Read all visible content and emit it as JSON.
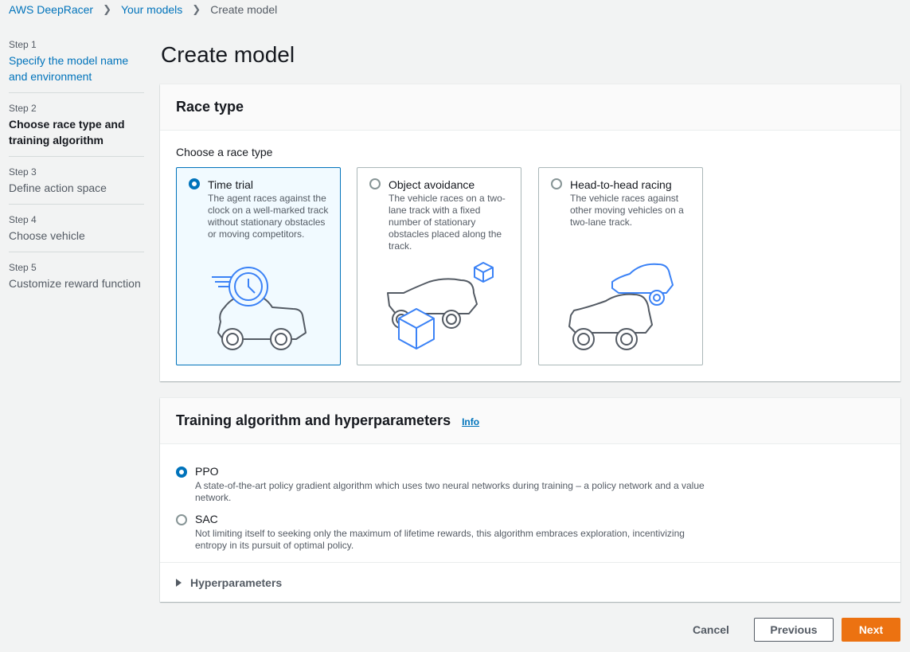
{
  "breadcrumb": {
    "items": [
      "AWS DeepRacer",
      "Your models"
    ],
    "current": "Create model"
  },
  "steps": [
    {
      "num": "Step 1",
      "label": "Specify the model name and environment",
      "state": "link"
    },
    {
      "num": "Step 2",
      "label": "Choose race type and training algorithm",
      "state": "active"
    },
    {
      "num": "Step 3",
      "label": "Define action space",
      "state": "disabled"
    },
    {
      "num": "Step 4",
      "label": "Choose vehicle",
      "state": "disabled"
    },
    {
      "num": "Step 5",
      "label": "Customize reward function",
      "state": "disabled"
    }
  ],
  "page_title": "Create model",
  "race_panel": {
    "title": "Race type",
    "choose_label": "Choose a race type",
    "tiles": [
      {
        "title": "Time trial",
        "desc": "The agent races against the clock on a well-marked track without stationary obstacles or moving competitors.",
        "selected": true
      },
      {
        "title": "Object avoidance",
        "desc": "The vehicle races on a two-lane track with a fixed number of stationary obstacles placed along the track.",
        "selected": false
      },
      {
        "title": "Head-to-head racing",
        "desc": "The vehicle races against other moving vehicles on a two-lane track.",
        "selected": false
      }
    ]
  },
  "algo_panel": {
    "title": "Training algorithm and hyperparameters",
    "info": "Info",
    "options": [
      {
        "title": "PPO",
        "desc": "A state-of-the-art policy gradient algorithm which uses two neural networks during training – a policy network and a value network.",
        "selected": true
      },
      {
        "title": "SAC",
        "desc": "Not limiting itself to seeking only the maximum of lifetime rewards, this algorithm embraces exploration, incentivizing entropy in its pursuit of optimal policy.",
        "selected": false
      }
    ],
    "hyperparameters": "Hyperparameters"
  },
  "footer": {
    "cancel": "Cancel",
    "previous": "Previous",
    "next": "Next"
  },
  "colors": {
    "accent": "#0073bb",
    "primary_button": "#ec7211",
    "illustration_blue": "#3b82f6"
  }
}
